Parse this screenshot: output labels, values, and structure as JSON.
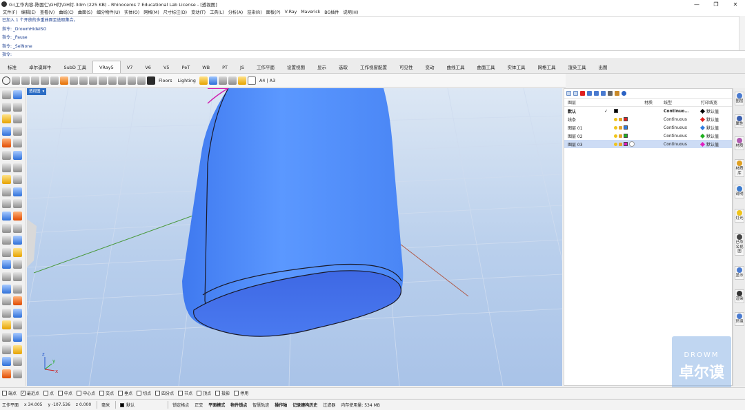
{
  "window": {
    "title": "G:\\工作内容-陈国仁\\GH灯\\GH灯.3dm (225 KB) - Rhinoceros 7 Educational Lab License - [透视图]",
    "minimize": "—",
    "maximize": "❐",
    "close": "✕"
  },
  "menu": [
    "文件(F)",
    "编辑(E)",
    "查看(V)",
    "曲线(C)",
    "曲面(S)",
    "细分物件(U)",
    "实体(O)",
    "网格(M)",
    "尺寸标注(D)",
    "变动(T)",
    "工具(L)",
    "分析(A)",
    "渲染(R)",
    "面板(P)",
    "V-Ray",
    "Maverick",
    "BG插件",
    "说明(H)"
  ],
  "command_history": [
    "已加入 1 个开放的多重曲面至选取集合。",
    "指令: _DrowmHideISO",
    "指令: _Pause",
    "指令: _SelNone"
  ],
  "command_prompt": "指令:",
  "tabs": [
    {
      "label": "标准",
      "active": false
    },
    {
      "label": "卓尔谟犀牛",
      "active": false
    },
    {
      "label": "SubD 工具",
      "active": false
    },
    {
      "label": "VRay5",
      "active": true
    },
    {
      "label": "V7",
      "active": false
    },
    {
      "label": "V6",
      "active": false
    },
    {
      "label": "V5",
      "active": false
    },
    {
      "label": "PeT",
      "active": false
    },
    {
      "label": "WB",
      "active": false
    },
    {
      "label": "PT",
      "active": false
    },
    {
      "label": "JS",
      "active": false
    },
    {
      "label": "工作平面",
      "active": false
    },
    {
      "label": "设置视图",
      "active": false
    },
    {
      "label": "显示",
      "active": false
    },
    {
      "label": "选取",
      "active": false
    },
    {
      "label": "工作视窗配置",
      "active": false
    },
    {
      "label": "可见性",
      "active": false
    },
    {
      "label": "变动",
      "active": false
    },
    {
      "label": "曲线工具",
      "active": false
    },
    {
      "label": "曲面工具",
      "active": false
    },
    {
      "label": "实体工具",
      "active": false
    },
    {
      "label": "网格工具",
      "active": false
    },
    {
      "label": "渲染工具",
      "active": false
    },
    {
      "label": "出图",
      "active": false
    }
  ],
  "toolbar": {
    "floors": "Floors",
    "lighting": "Lighting",
    "paper": "A4 | A3"
  },
  "viewport": {
    "label": "透视图",
    "dropdown": "▾",
    "axis_x": "x",
    "axis_y": "y",
    "axis_z": "z"
  },
  "layers": {
    "headers": {
      "name": "图层",
      "material": "材质",
      "linetype": "线型",
      "printwidth": "打印线宽"
    },
    "rows": [
      {
        "name": "默认",
        "current": "✓",
        "color": "#000000",
        "linetype": "Continuo…",
        "printcolor": "#000000",
        "print": "默认值",
        "bold": true,
        "selected": false
      },
      {
        "name": "线条",
        "current": "",
        "color": "#e02020",
        "linetype": "Continuous",
        "printcolor": "#e02020",
        "print": "默认值",
        "bold": false,
        "selected": false
      },
      {
        "name": "图层 01",
        "current": "",
        "color": "#2f7be0",
        "linetype": "Continuous",
        "printcolor": "#2f7be0",
        "print": "默认值",
        "bold": false,
        "selected": false
      },
      {
        "name": "图层 02",
        "current": "",
        "color": "#20b020",
        "linetype": "Continuous",
        "printcolor": "#20b020",
        "print": "默认值",
        "bold": false,
        "selected": false
      },
      {
        "name": "图层 03",
        "current": "",
        "color": "#e020c0",
        "linetype": "Continuous",
        "printcolor": "#e020c0",
        "print": "默认值",
        "bold": false,
        "selected": true
      }
    ]
  },
  "right_panels": [
    "图层",
    "属性",
    "材质",
    "材质库",
    "说明",
    "灯光",
    "已命名视图",
    "显示",
    "渲染",
    "环境"
  ],
  "osnaps": [
    {
      "label": "端点",
      "checked": false
    },
    {
      "label": "最近点",
      "checked": true
    },
    {
      "label": "点",
      "checked": false
    },
    {
      "label": "中点",
      "checked": false
    },
    {
      "label": "中心点",
      "checked": false
    },
    {
      "label": "交点",
      "checked": false
    },
    {
      "label": "垂点",
      "checked": false
    },
    {
      "label": "切点",
      "checked": false
    },
    {
      "label": "四分点",
      "checked": false
    },
    {
      "label": "节点",
      "checked": false
    },
    {
      "label": "顶点",
      "checked": false
    },
    {
      "label": "投影",
      "checked": false
    },
    {
      "label": "停用",
      "checked": false
    }
  ],
  "status": {
    "cplane": "工作平面",
    "x": "x 34.005",
    "y": "y -107.536",
    "z": "z 0.000",
    "units": "毫米",
    "layer": "默认",
    "items": [
      {
        "label": "锁定格点",
        "bold": false
      },
      {
        "label": "正交",
        "bold": false
      },
      {
        "label": "平面模式",
        "bold": true
      },
      {
        "label": "物件锁点",
        "bold": true
      },
      {
        "label": "智慧轨迹",
        "bold": false
      },
      {
        "label": "操作轴",
        "bold": true
      },
      {
        "label": "记录建构历史",
        "bold": true
      },
      {
        "label": "过滤器",
        "bold": false
      }
    ],
    "memory": "内存使用量: 534 MB"
  },
  "watermark": {
    "line1": "DROWM",
    "line2": "卓尔谟"
  },
  "colors": {
    "accent": "#2b6cc4",
    "viewport_bg": "#c6d8ef",
    "model_blue": "#4e8af7"
  }
}
